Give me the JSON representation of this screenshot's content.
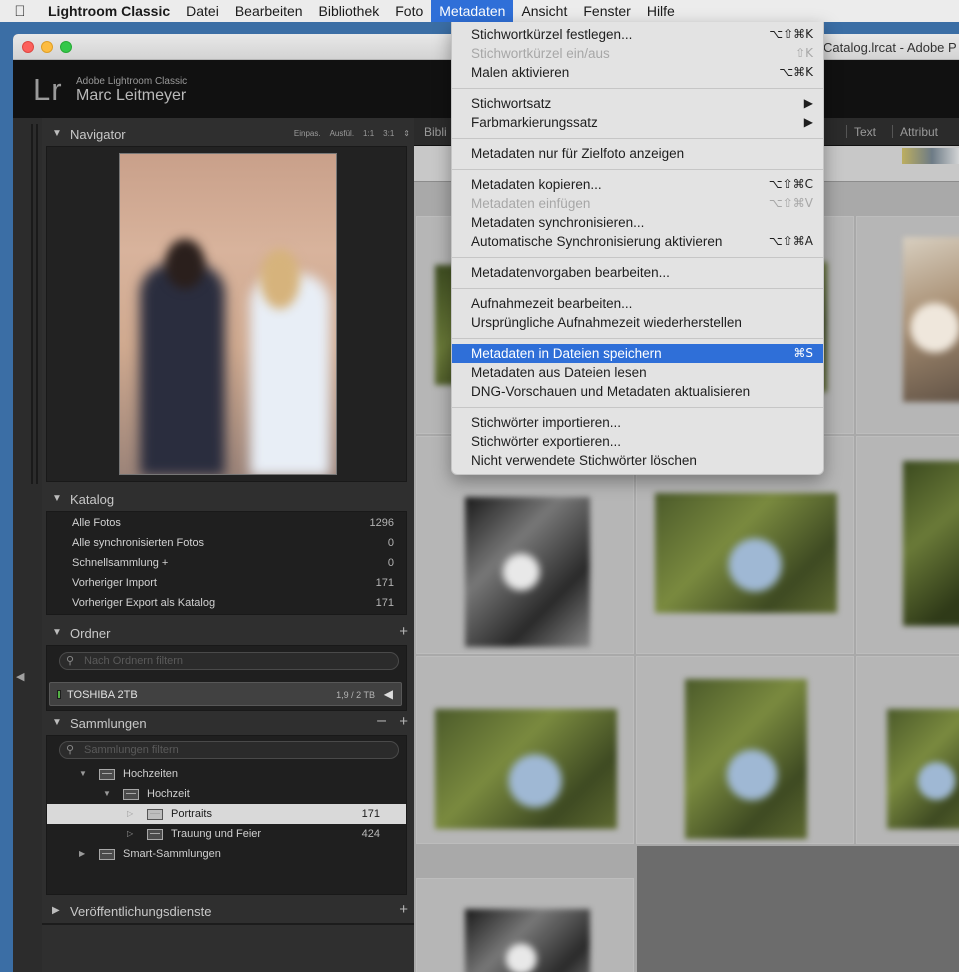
{
  "menubar": {
    "app": "Lightroom Classic",
    "items": [
      "Datei",
      "Bearbeiten",
      "Bibliothek",
      "Foto",
      "Metadaten",
      "Ansicht",
      "Fenster",
      "Hilfe"
    ]
  },
  "window": {
    "title": "Catalog.lrcat - Adobe P"
  },
  "identity": {
    "logo": "Lr",
    "app_name": "Adobe Lightroom Classic",
    "user": "Marc Leitmeyer"
  },
  "navigator": {
    "title": "Navigator",
    "opts": [
      "Einpas.",
      "Ausfül.",
      "1:1",
      "3:1"
    ]
  },
  "katalog": {
    "title": "Katalog",
    "rows": [
      {
        "label": "Alle Fotos",
        "count": "1296"
      },
      {
        "label": "Alle synchronisierten Fotos",
        "count": "0"
      },
      {
        "label": "Schnellsammlung +",
        "count": "0"
      },
      {
        "label": "Vorheriger Import",
        "count": "171"
      },
      {
        "label": "Vorheriger Export als Katalog",
        "count": "171"
      }
    ]
  },
  "ordner": {
    "title": "Ordner",
    "filter_placeholder": "Nach Ordnern filtern",
    "volume": {
      "name": "TOSHIBA 2TB",
      "size": "1,9 / 2 TB"
    }
  },
  "sammlungen": {
    "title": "Sammlungen",
    "filter_placeholder": "Sammlungen filtern",
    "tree": [
      {
        "label": "Hochzeiten",
        "count": ""
      },
      {
        "label": "Hochzeit",
        "count": ""
      },
      {
        "label": "Portraits",
        "count": "171"
      },
      {
        "label": "Trauung und Feier",
        "count": "424"
      },
      {
        "label": "Smart-Sammlungen",
        "count": ""
      }
    ]
  },
  "publish": {
    "title": "Veröffentlichungsdienste"
  },
  "filterbar": {
    "left": "Bibli",
    "text": "Text",
    "attr": "Attribut"
  },
  "menu": {
    "groups": [
      [
        {
          "label": "Stichwortkürzel festlegen...",
          "shortcut": "⌥⇧⌘K",
          "enabled": true
        },
        {
          "label": "Stichwortkürzel ein/aus",
          "shortcut": "⇧K",
          "enabled": false
        },
        {
          "label": "Malen aktivieren",
          "shortcut": "⌥⌘K",
          "enabled": true
        }
      ],
      [
        {
          "label": "Stichwortsatz",
          "shortcut": "▶",
          "enabled": true
        },
        {
          "label": "Farbmarkierungssatz",
          "shortcut": "▶",
          "enabled": true
        }
      ],
      [
        {
          "label": "Metadaten nur für Zielfoto anzeigen",
          "shortcut": "",
          "enabled": true
        }
      ],
      [
        {
          "label": "Metadaten kopieren...",
          "shortcut": "⌥⇧⌘C",
          "enabled": true
        },
        {
          "label": "Metadaten einfügen",
          "shortcut": "⌥⇧⌘V",
          "enabled": false
        },
        {
          "label": "Metadaten synchronisieren...",
          "shortcut": "",
          "enabled": true
        },
        {
          "label": "Automatische Synchronisierung aktivieren",
          "shortcut": "⌥⇧⌘A",
          "enabled": true
        }
      ],
      [
        {
          "label": "Metadatenvorgaben bearbeiten...",
          "shortcut": "",
          "enabled": true
        }
      ],
      [
        {
          "label": "Aufnahmezeit bearbeiten...",
          "shortcut": "",
          "enabled": true
        },
        {
          "label": "Ursprüngliche Aufnahmezeit wiederherstellen",
          "shortcut": "",
          "enabled": true
        }
      ],
      [
        {
          "label": "Metadaten in Dateien speichern",
          "shortcut": "⌘S",
          "enabled": true,
          "highlighted": true
        },
        {
          "label": "Metadaten aus Dateien lesen",
          "shortcut": "",
          "enabled": true
        },
        {
          "label": "DNG-Vorschauen und Metadaten aktualisieren",
          "shortcut": "",
          "enabled": true
        }
      ],
      [
        {
          "label": "Stichwörter importieren...",
          "shortcut": "",
          "enabled": true
        },
        {
          "label": "Stichwörter exportieren...",
          "shortcut": "",
          "enabled": true
        },
        {
          "label": "Nicht verwendete Stichwörter löschen",
          "shortcut": "",
          "enabled": true
        }
      ]
    ]
  },
  "colors": {
    "menu_highlight": "#2f6fd8",
    "desktop": "#3b6ea5",
    "volume_led": "#53b145"
  }
}
